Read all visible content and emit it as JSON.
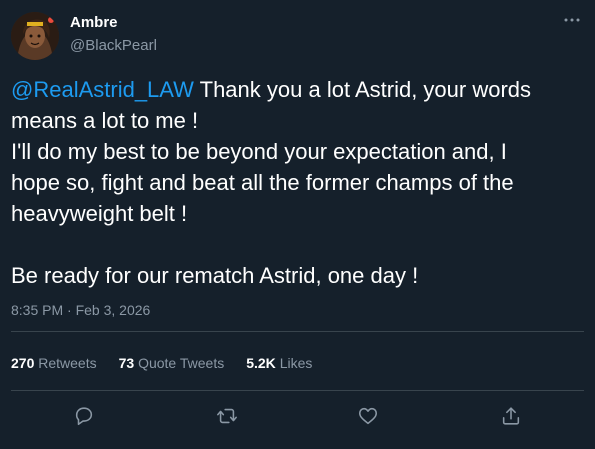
{
  "author": {
    "display_name": "Ambre",
    "handle": "@BlackPearl"
  },
  "tweet": {
    "mention": "@RealAstrid_LAW",
    "line1_rest": " Thank you a lot Astrid, your words",
    "line2": "means a lot to me !",
    "line3": "I'll do my best to be beyond your expectation and, I",
    "line4": "hope so, fight and beat all the former champs of the",
    "line5": "heavyweight belt !",
    "line6": "Be ready for our rematch Astrid, one day !"
  },
  "timestamp": "8:35 PM · Feb 3, 2026",
  "stats": {
    "retweets_count": "270",
    "retweets_label": "Retweets",
    "quote_count": "73",
    "quote_label": "Quote Tweets",
    "likes_count": "5.2K",
    "likes_label": "Likes"
  },
  "icons": {
    "more": "more-horizontal-icon",
    "reply": "reply-icon",
    "retweet": "retweet-icon",
    "like": "heart-icon",
    "share": "share-icon"
  },
  "colors": {
    "background": "#15202b",
    "accent": "#1d9bf0",
    "secondary_text": "#8b98a5",
    "divider": "#38444d"
  }
}
